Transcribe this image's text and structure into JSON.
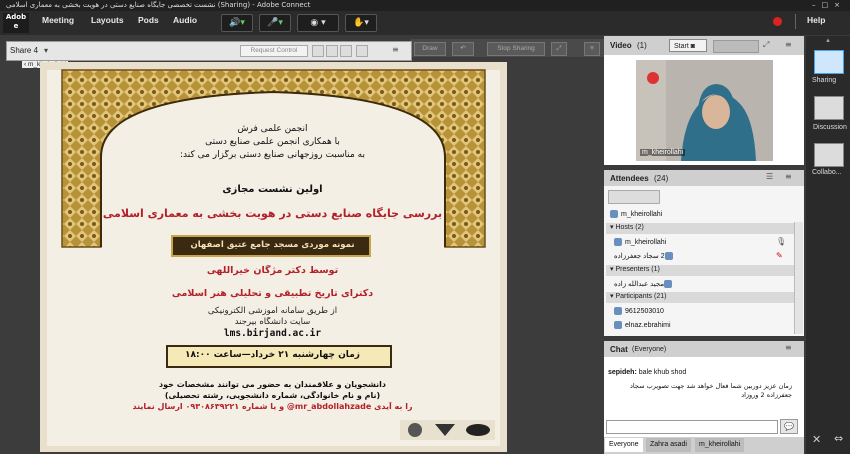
{
  "window_title": "نشست تخصصی جایگاه صنایع دستی در هویت بخشی به معماری اسلامی (Sharing) - Adobe Connect",
  "logo": {
    "line1": "Adob",
    "line2": "e"
  },
  "menu": {
    "meeting": "Meeting",
    "layouts": "Layouts",
    "pods": "Pods",
    "audio": "Audio",
    "help": "Help"
  },
  "share": {
    "title": "Share 4",
    "presenter_tag": "m_kheirollahi",
    "request_control": "Request Control",
    "draw": "Draw",
    "stop_sharing": "Stop Sharing"
  },
  "poster": {
    "line1": "انجمن علمی فرش",
    "line2": "با همکاری انجمن علمی صنایع دستی",
    "line3": "به مناسبت روزجهانی صنایع دستی برگزار می کند:",
    "line4": "اولین نشست مجازی",
    "line5": "بررسی جایگاه صنایع دستی در هویت بخشی به معماری اسلامی",
    "line6": "نمونه موردی مسجد جامع عتیق اصفهان",
    "line7": "توسط دکتر مژگان خیراللهی",
    "line8": "دکترای تاریخ تطبیقی و تحلیلی هنر اسلامی",
    "line9": "از طریق سامانه آموزشی الکترونیکی",
    "line10": "سایت دانشگاه بیرجند",
    "line11": "lms.birjand.ac.ir",
    "line12": "زمان چهارشنبه ۲۱ خرداد—ساعت ۱۸:۰۰",
    "line13": "دانشجویان و علاقمندان به حضور می توانند مشخصات خود",
    "line14": "(نام و نام خانوادگی، شماره دانشجویی، رشته تحصیلی)",
    "line15": "را به آیدی mr_abdollahzade@ و یا شماره ۰۹۳۰۸۶۳۹۲۲۱ ارسال نمایند"
  },
  "video": {
    "title": "Video",
    "count": "(1)",
    "start_label": "Start",
    "caption": "m_kheirollahi"
  },
  "attendees": {
    "title": "Attendees",
    "count": "(24)",
    "me": "m_kheirollahi",
    "hosts_label": "Hosts (2)",
    "hosts": [
      "m_kheirollahi",
      "2 سجاد جعفرزاده"
    ],
    "presenters_label": "Presenters (1)",
    "presenters": [
      "مجید عبدالله زاده"
    ],
    "participants_label": "Participants (21)",
    "participants": [
      "9612503010",
      "elnaz.ebrahimi"
    ]
  },
  "chat": {
    "title": "Chat",
    "scope": "(Everyone)",
    "sender": "sepideh:",
    "msg1": "bale khub shod",
    "msg2": "زمان عزیز دوربین شما فعال خواهد شد جهت تصویرب سجاد جعفرزاده 2 وروزاد",
    "tabs": [
      "Everyone",
      "Zahra asadi",
      "m_kheirollahi"
    ]
  },
  "layouts": {
    "sharing": "Sharing",
    "discussion": "Discussion",
    "collab": "Collabo..."
  },
  "colors": {
    "accent_red": "#c0262d",
    "poster_title_red": "#b3202a",
    "gold": "#c9a54a"
  }
}
